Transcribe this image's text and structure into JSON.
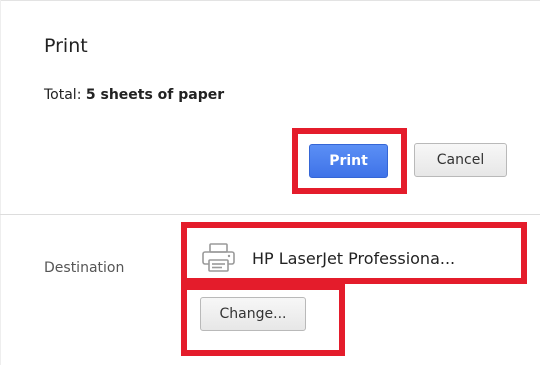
{
  "dialog": {
    "title": "Print",
    "total_label": "Total:",
    "total_value": "5 sheets of paper"
  },
  "actions": {
    "print_label": "Print",
    "cancel_label": "Cancel"
  },
  "destination": {
    "label": "Destination",
    "printer_name": "HP LaserJet Professiona...",
    "printer_icon": "printer-icon",
    "change_label": "Change..."
  },
  "colors": {
    "primary_button": "#4a80f0",
    "highlight": "#e41c2b"
  }
}
